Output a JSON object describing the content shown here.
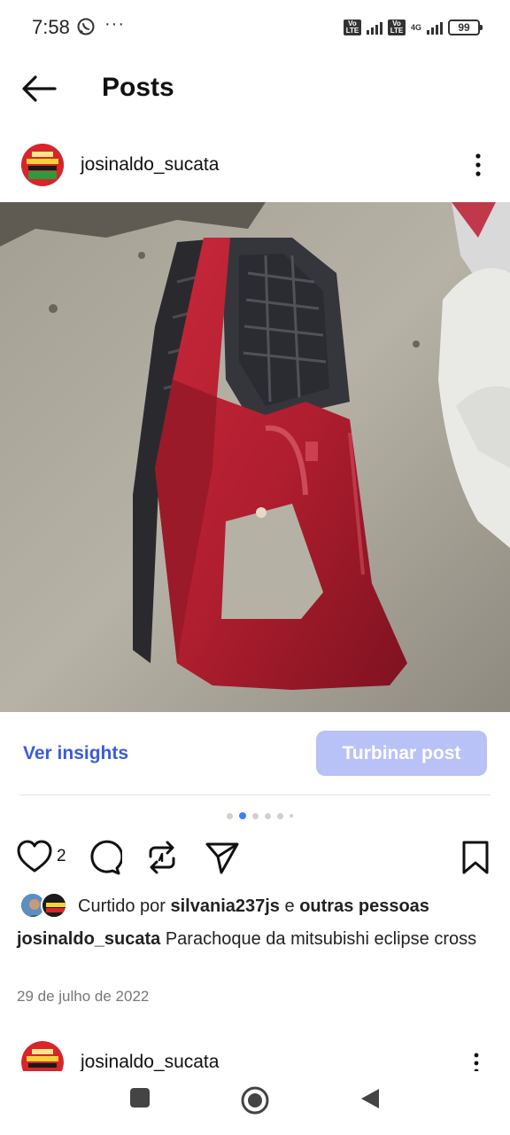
{
  "status_bar": {
    "time": "7:58",
    "more": "···",
    "volte1": "Vo LTE",
    "volte2": "Vo LTE",
    "network": "4G",
    "battery": "99"
  },
  "header": {
    "title": "Posts"
  },
  "post": {
    "username": "josinaldo_sucata",
    "insights_label": "Ver insights",
    "boost_label": "Turbinar post",
    "carousel_total": 6,
    "carousel_active": 2,
    "like_count": "2",
    "liked_by_prefix": "Curtido por",
    "liked_by_user": "silvania237js",
    "liked_by_mid": "e",
    "liked_by_others": "outras pessoas",
    "caption_user": "josinaldo_sucata",
    "caption_text": "Parachoque da mitsubishi eclipse cross",
    "date": "29 de julho de 2022"
  },
  "next_post": {
    "username": "josinaldo_sucata"
  },
  "icons": {
    "back": "arrow-left-icon",
    "more": "kebab-menu-icon",
    "like": "heart-icon",
    "comment": "comment-icon",
    "repost": "repost-icon",
    "share": "send-icon",
    "save": "bookmark-icon"
  },
  "colors": {
    "accent": "#3b5bdb",
    "boost_button": "#b9c2f7",
    "carousel_active": "#3b82f6"
  }
}
